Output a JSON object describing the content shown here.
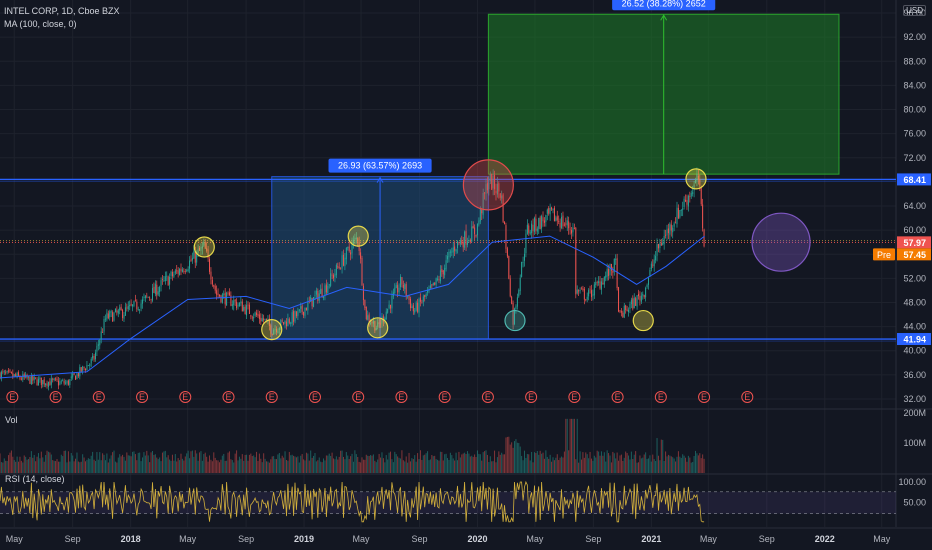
{
  "header": {
    "symbol_line": "INTEL CORP, 1D, Cboe BZX",
    "ma_line": "MA (100, close, 0)",
    "vol_label": "Vol",
    "rsi_label": "RSI (14, close)",
    "currency": "USD"
  },
  "colors": {
    "background": "#131722",
    "grid": "#1e222d",
    "up": "#26a69a",
    "down": "#ef5350",
    "ma": "#2962ff",
    "rsi": "#d4b13c",
    "level_line": "#2962ff",
    "measure_box": "#1e4d78",
    "target_box": "#1e7d26",
    "yellow_circle": "#e6d84a",
    "red_circle": "#e04b4b",
    "teal_circle": "#4fb8b0",
    "purple_circle": "#7e57c2"
  },
  "badges": {
    "current_price": "57.97",
    "pre_tag": "Pre",
    "pre_price": "57.45",
    "resistance": "68.41",
    "support": "41.94"
  },
  "chart_data": {
    "type": "candlestick",
    "symbol": "INTEL CORP",
    "interval": "1D",
    "y_axis_ticks": [
      "96.00",
      "92.00",
      "88.00",
      "84.00",
      "80.00",
      "76.00",
      "72.00",
      "64.00",
      "60.00",
      "56.00",
      "52.00",
      "48.00",
      "44.00",
      "40.00",
      "36.00",
      "32.00"
    ],
    "ylim": [
      30.5,
      97.5
    ],
    "x_axis_ticks": [
      "May",
      "Sep",
      "2018",
      "May",
      "Sep",
      "2019",
      "May",
      "Sep",
      "2020",
      "May",
      "Sep",
      "2021",
      "May",
      "Sep",
      "2022",
      "May"
    ],
    "xlim": [
      "2017-04-01",
      "2022-05-31"
    ],
    "volume_axis_ticks": [
      "200M",
      "100M"
    ],
    "rsi_axis_ticks": [
      "100.00",
      "50.00"
    ],
    "rsi_bands": [
      70,
      30
    ],
    "price_path": [
      {
        "date": "2017-04-01",
        "value": 36.2
      },
      {
        "date": "2017-06-15",
        "value": 35.0
      },
      {
        "date": "2017-08-20",
        "value": 34.6
      },
      {
        "date": "2017-10-15",
        "value": 38.5
      },
      {
        "date": "2017-11-10",
        "value": 45.5
      },
      {
        "date": "2017-12-20",
        "value": 46.5
      },
      {
        "date": "2018-01-25",
        "value": 48.0
      },
      {
        "date": "2018-03-15",
        "value": 51.5
      },
      {
        "date": "2018-05-10",
        "value": 55.0
      },
      {
        "date": "2018-06-05",
        "value": 57.2
      },
      {
        "date": "2018-06-30",
        "value": 49.5
      },
      {
        "date": "2018-08-20",
        "value": 47.5
      },
      {
        "date": "2018-10-10",
        "value": 45.0
      },
      {
        "date": "2018-10-25",
        "value": 43.5
      },
      {
        "date": "2018-12-20",
        "value": 46.0
      },
      {
        "date": "2019-02-15",
        "value": 50.5
      },
      {
        "date": "2019-04-25",
        "value": 59.0
      },
      {
        "date": "2019-05-10",
        "value": 46.0
      },
      {
        "date": "2019-06-05",
        "value": 43.8
      },
      {
        "date": "2019-07-25",
        "value": 51.5
      },
      {
        "date": "2019-08-20",
        "value": 46.5
      },
      {
        "date": "2019-10-05",
        "value": 51.0
      },
      {
        "date": "2019-11-15",
        "value": 57.5
      },
      {
        "date": "2019-12-30",
        "value": 60.0
      },
      {
        "date": "2020-01-24",
        "value": 68.5
      },
      {
        "date": "2020-02-20",
        "value": 66.0
      },
      {
        "date": "2020-03-16",
        "value": 45.0
      },
      {
        "date": "2020-04-15",
        "value": 60.0
      },
      {
        "date": "2020-06-05",
        "value": 62.5
      },
      {
        "date": "2020-07-23",
        "value": 60.0
      },
      {
        "date": "2020-07-24",
        "value": 50.0
      },
      {
        "date": "2020-08-20",
        "value": 49.0
      },
      {
        "date": "2020-10-20",
        "value": 54.5
      },
      {
        "date": "2020-10-23",
        "value": 45.5
      },
      {
        "date": "2020-12-15",
        "value": 49.5
      },
      {
        "date": "2021-01-15",
        "value": 57.0
      },
      {
        "date": "2021-02-20",
        "value": 62.0
      },
      {
        "date": "2021-04-10",
        "value": 68.5
      },
      {
        "date": "2021-04-23",
        "value": 57.5
      }
    ],
    "ma_path": [
      {
        "date": "2017-04-01",
        "value": 35.5
      },
      {
        "date": "2017-10-01",
        "value": 36.5
      },
      {
        "date": "2018-01-01",
        "value": 42.0
      },
      {
        "date": "2018-05-01",
        "value": 48.5
      },
      {
        "date": "2018-09-01",
        "value": 49.0
      },
      {
        "date": "2018-12-01",
        "value": 47.0
      },
      {
        "date": "2019-04-01",
        "value": 50.5
      },
      {
        "date": "2019-08-01",
        "value": 49.0
      },
      {
        "date": "2019-11-01",
        "value": 51.0
      },
      {
        "date": "2020-02-01",
        "value": 58.0
      },
      {
        "date": "2020-06-01",
        "value": 59.0
      },
      {
        "date": "2020-09-01",
        "value": 55.5
      },
      {
        "date": "2020-12-01",
        "value": 51.0
      },
      {
        "date": "2021-02-01",
        "value": 54.0
      },
      {
        "date": "2021-04-23",
        "value": 59.0
      }
    ],
    "horizontal_levels": [
      {
        "label": "68.41",
        "value": 68.41
      },
      {
        "label": "41.94",
        "value": 41.94
      }
    ],
    "current_price_line": 57.97,
    "measure_ranges": [
      {
        "label": "26.93 (63.57%) 2693",
        "x_start": "2018-10-25",
        "x_end": "2020-01-24",
        "y_start": 41.94,
        "y_end": 68.87
      },
      {
        "label": "26.52 (38.28%) 2652",
        "x_start": "2020-01-24",
        "x_end": "2022-01-31",
        "y_start": 69.28,
        "y_end": 95.8
      }
    ],
    "circled_points": [
      {
        "kind": "yellow",
        "date": "2018-06-05",
        "value": 57.2
      },
      {
        "kind": "yellow",
        "date": "2018-10-25",
        "value": 43.5
      },
      {
        "kind": "yellow",
        "date": "2019-04-25",
        "value": 59.0
      },
      {
        "kind": "yellow",
        "date": "2019-06-05",
        "value": 43.8
      },
      {
        "kind": "red",
        "date": "2020-01-24",
        "value": 67.5
      },
      {
        "kind": "teal",
        "date": "2020-03-20",
        "value": 45.0
      },
      {
        "kind": "yellow",
        "date": "2020-12-15",
        "value": 45.0
      },
      {
        "kind": "yellow",
        "date": "2021-04-05",
        "value": 68.5
      },
      {
        "kind": "purple",
        "date": "2021-10-01",
        "value": 58.0
      }
    ],
    "earnings_markers": [
      "2017-04-27",
      "2017-07-27",
      "2017-10-26",
      "2018-01-25",
      "2018-04-26",
      "2018-07-26",
      "2018-10-25",
      "2019-01-24",
      "2019-04-25",
      "2019-07-25",
      "2019-10-24",
      "2020-01-23",
      "2020-04-23",
      "2020-07-23",
      "2020-10-22",
      "2021-01-21",
      "2021-04-22",
      "2021-07-22"
    ],
    "earnings_marker_text": "E"
  }
}
